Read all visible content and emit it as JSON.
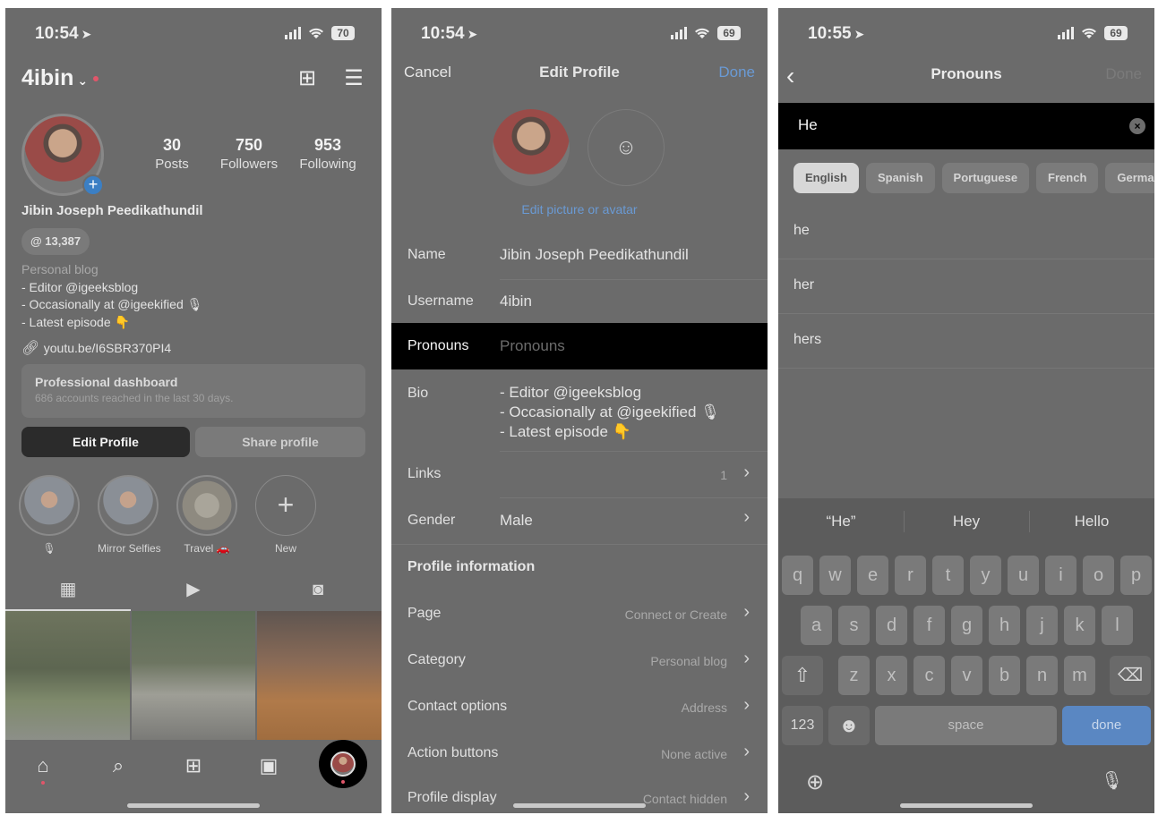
{
  "panel1": {
    "status": {
      "time": "10:54",
      "battery": "70"
    },
    "header": {
      "username": "4ibin",
      "chevron": "⌄",
      "create_icon": "⊞",
      "menu_icon": "☰"
    },
    "avatar_badge": "+",
    "stats": [
      {
        "value": "30",
        "label": "Posts"
      },
      {
        "value": "750",
        "label": "Followers"
      },
      {
        "value": "953",
        "label": "Following"
      }
    ],
    "full_name": "Jibin Joseph Peedikathundil",
    "threads_count": "13,387",
    "bio": {
      "category": "Personal blog",
      "lines": [
        "- Editor @igeeksblog",
        "- Occasionally at @igeekified 🎙",
        "- Latest episode 👇"
      ]
    },
    "link": "youtu.be/I6SBR370PI4",
    "dashboard": {
      "title": "Professional dashboard",
      "subtitle": "686 accounts reached in the last 30 days."
    },
    "buttons": {
      "edit": "Edit Profile",
      "share": "Share profile"
    },
    "highlights": [
      {
        "label": "🎙"
      },
      {
        "label": "Mirror Selfies"
      },
      {
        "label": "Travel 🚗"
      },
      {
        "label": "New",
        "icon": "+"
      }
    ],
    "tabs": {
      "grid_icon": "▦",
      "reels_icon": "▶",
      "tagged_icon": "◙"
    },
    "nav": {
      "home_icon": "⌂",
      "search_icon": "⌕",
      "add_icon": "⊞",
      "reels_icon": "▣"
    }
  },
  "panel2": {
    "status": {
      "time": "10:54",
      "battery": "69"
    },
    "topbar": {
      "cancel": "Cancel",
      "title": "Edit Profile",
      "done": "Done"
    },
    "avatar_icon": "☺",
    "edit_picture": "Edit picture or avatar",
    "fields": {
      "name": {
        "label": "Name",
        "value": "Jibin Joseph Peedikathundil"
      },
      "username": {
        "label": "Username",
        "value": "4ibin"
      },
      "pronouns": {
        "label": "Pronouns",
        "placeholder": "Pronouns"
      },
      "bio": {
        "label": "Bio",
        "lines": [
          "- Editor @igeeksblog",
          "- Occasionally at @igeekified 🎙",
          "- Latest episode 👇"
        ]
      },
      "links": {
        "label": "Links",
        "value": "1"
      },
      "gender": {
        "label": "Gender",
        "value": "Male"
      }
    },
    "section_title": "Profile information",
    "info_rows": [
      {
        "label": "Page",
        "value": "Connect or Create"
      },
      {
        "label": "Category",
        "value": "Personal blog"
      },
      {
        "label": "Contact options",
        "value": "Address"
      },
      {
        "label": "Action buttons",
        "value": "None active"
      },
      {
        "label": "Profile display",
        "value": "Contact hidden"
      }
    ],
    "chevron": "›"
  },
  "panel3": {
    "status": {
      "time": "10:55",
      "battery": "69"
    },
    "topbar": {
      "back": "‹",
      "title": "Pronouns",
      "done": "Done"
    },
    "search_value": "He",
    "clear_icon": "×",
    "languages": [
      {
        "label": "English",
        "selected": true
      },
      {
        "label": "Spanish"
      },
      {
        "label": "Portuguese"
      },
      {
        "label": "French"
      },
      {
        "label": "Germa"
      }
    ],
    "suggestions": [
      "he",
      "her",
      "hers"
    ],
    "keyboard": {
      "predictions": [
        "“He”",
        "Hey",
        "Hello"
      ],
      "row1": [
        "q",
        "w",
        "e",
        "r",
        "t",
        "y",
        "u",
        "i",
        "o",
        "p"
      ],
      "row2": [
        "a",
        "s",
        "d",
        "f",
        "g",
        "h",
        "j",
        "k",
        "l"
      ],
      "row3": [
        "z",
        "x",
        "c",
        "v",
        "b",
        "n",
        "m"
      ],
      "shift": "⇧",
      "delete": "⌫",
      "numbers": "123",
      "emoji": "☻",
      "space": "space",
      "done": "done",
      "globe": "⊕",
      "mic": "🎙"
    }
  }
}
